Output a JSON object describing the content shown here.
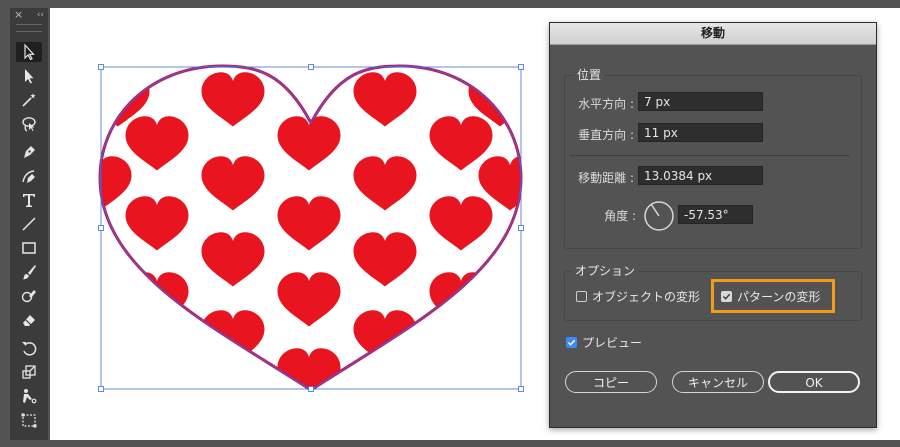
{
  "toolbar": {
    "close_glyph": "×",
    "collapse_glyph": "‹‹",
    "tools": [
      {
        "name": "selection-tool-icon",
        "active": true
      },
      {
        "name": "direct-selection-tool-icon",
        "active": false
      },
      {
        "name": "magic-wand-tool-icon",
        "active": false
      },
      {
        "name": "lasso-tool-icon",
        "active": false
      },
      {
        "name": "pen-tool-icon",
        "active": false
      },
      {
        "name": "curvature-tool-icon",
        "active": false
      },
      {
        "name": "type-tool-icon",
        "active": false
      },
      {
        "name": "line-segment-tool-icon",
        "active": false
      },
      {
        "name": "rectangle-tool-icon",
        "active": false
      },
      {
        "name": "paintbrush-tool-icon",
        "active": false
      },
      {
        "name": "shaper-tool-icon",
        "active": false
      },
      {
        "name": "eraser-tool-icon",
        "active": false
      },
      {
        "name": "rotate-tool-icon",
        "active": false
      },
      {
        "name": "scale-tool-icon",
        "active": false
      },
      {
        "name": "puppet-warp-tool-icon",
        "active": false
      },
      {
        "name": "free-transform-tool-icon",
        "active": false
      }
    ]
  },
  "artwork": {
    "shape": "heart-with-heart-pattern",
    "pattern_color": "#e8141f",
    "outline_color": "#c2185b",
    "selection_color": "#3d6fd8"
  },
  "dialog": {
    "title": "移動",
    "position_group": {
      "label": "位置",
      "horizontal_label": "水平方向 :",
      "horizontal_value": "7 px",
      "vertical_label": "垂直方向 :",
      "vertical_value": "11 px",
      "distance_label": "移動距離 :",
      "distance_value": "13.0384 px",
      "angle_label": "角度 :",
      "angle_value": "-57.53°"
    },
    "options_group": {
      "label": "オプション",
      "transform_objects_label": "オブジェクトの変形",
      "transform_objects_checked": false,
      "transform_patterns_label": "パターンの変形",
      "transform_patterns_checked": true
    },
    "preview_label": "プレビュー",
    "preview_checked": true,
    "buttons": {
      "copy": "コピー",
      "cancel": "キャンセル",
      "ok": "OK"
    },
    "highlight_color": "#f29b15"
  }
}
